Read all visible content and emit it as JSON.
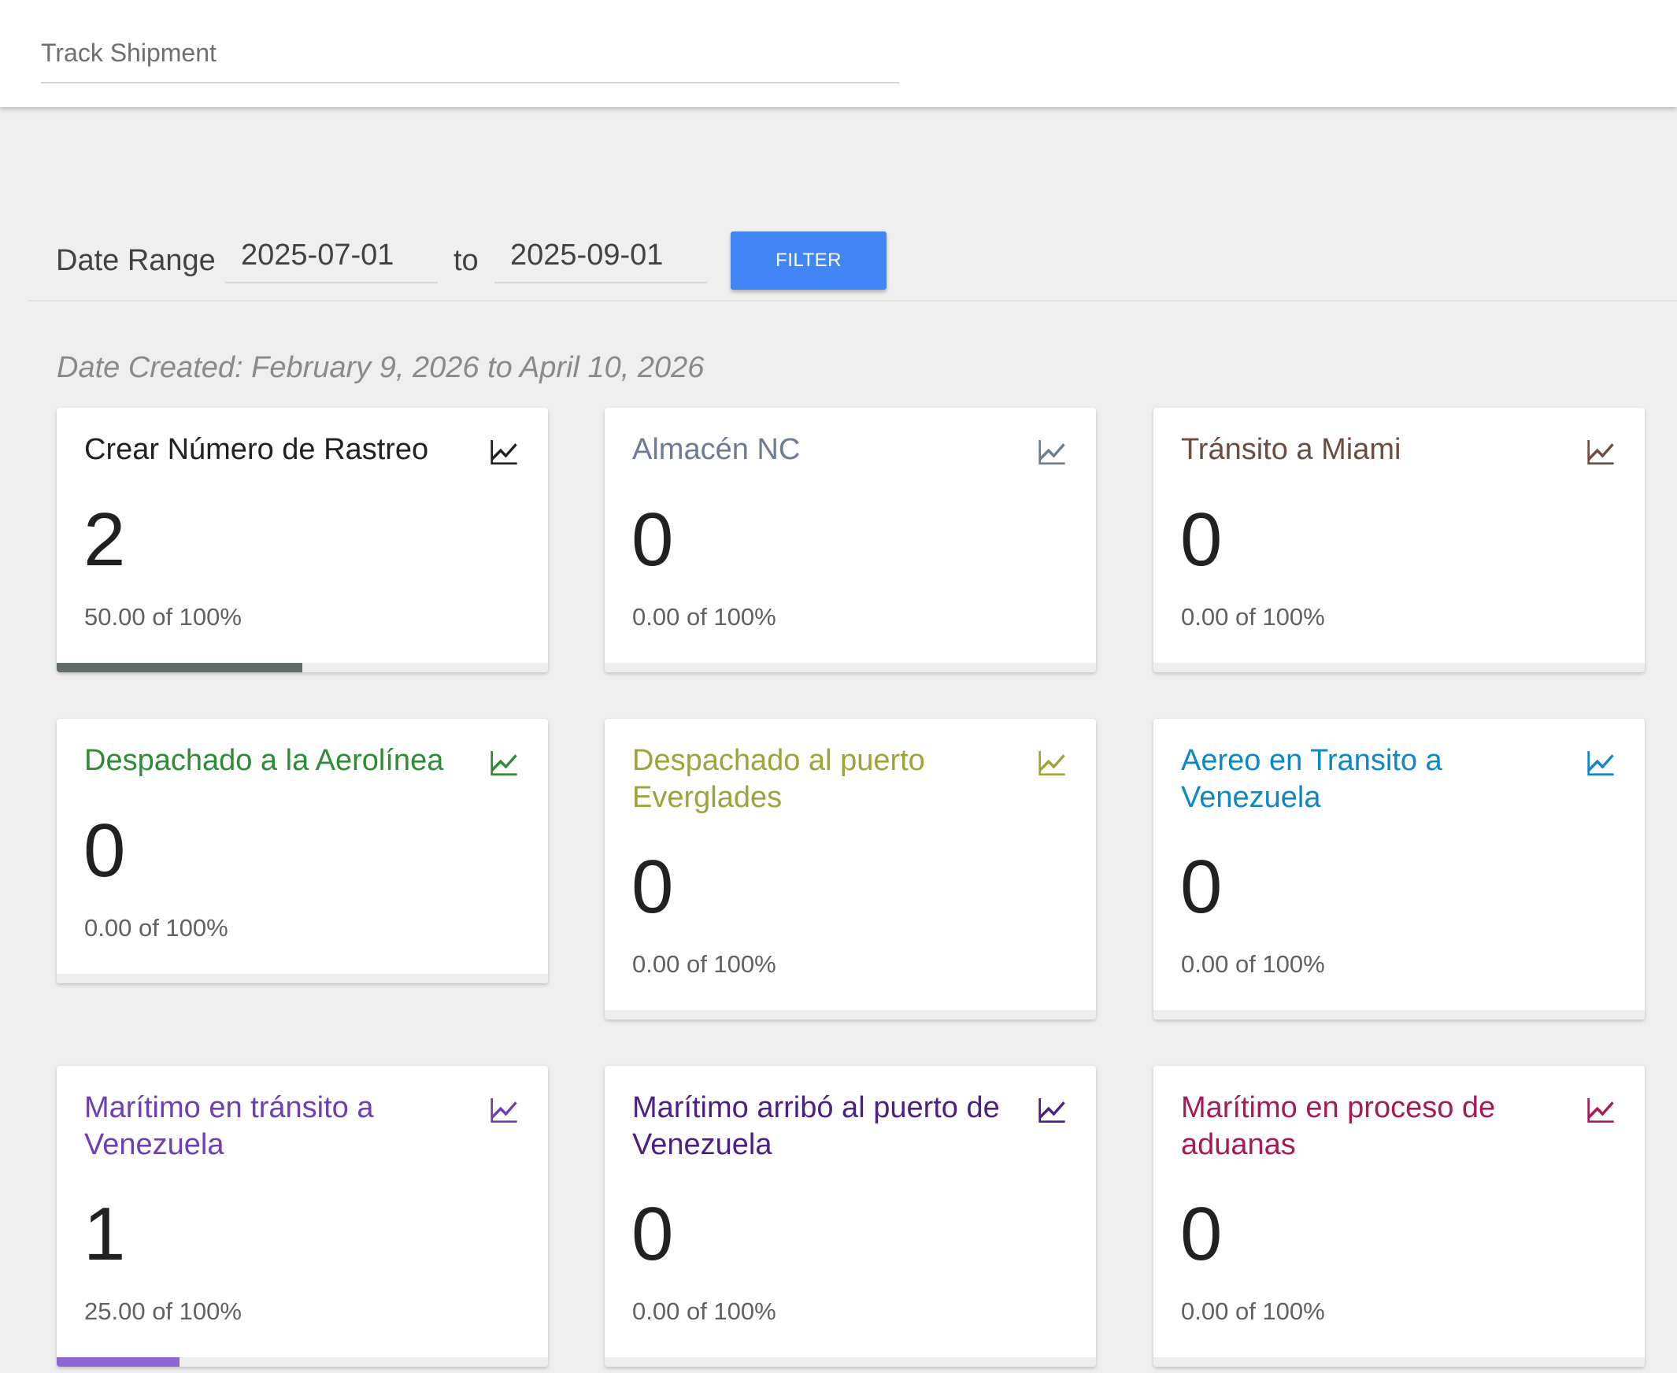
{
  "header": {
    "track_placeholder": "Track Shipment"
  },
  "filter": {
    "label": "Date Range",
    "from_value": "2025-07-01",
    "to_label": "to",
    "to_value": "2025-09-01",
    "button_label": "FILTER",
    "button_color": "#4285f4"
  },
  "date_created": "Date Created: February 9, 2026 to April 10, 2026",
  "cards": [
    {
      "title": "Crear Número de Rastreo",
      "count": "2",
      "percent_text": "50.00 of 100%",
      "progress": 0.5,
      "color": "#212121",
      "bar_color": "#616b6b",
      "icon": "trending-up-chart-icon"
    },
    {
      "title": "Almacén NC",
      "count": "0",
      "percent_text": "0.00 of 100%",
      "progress": 0,
      "color": "#6d7b95",
      "bar_color": "#6d7b95",
      "icon": "trending-up-chart-icon"
    },
    {
      "title": "Tránsito a Miami",
      "count": "0",
      "percent_text": "0.00 of 100%",
      "progress": 0,
      "color": "#6d4c41",
      "bar_color": "#6d4c41",
      "icon": "trending-up-chart-icon"
    },
    {
      "title": "Despachado a la Aerolínea",
      "count": "0",
      "percent_text": "0.00 of 100%",
      "progress": 0,
      "color": "#2e8b36",
      "bar_color": "#2e8b36",
      "icon": "trending-up-chart-icon"
    },
    {
      "title": "Despachado al puerto Everglades",
      "count": "0",
      "percent_text": "0.00 of 100%",
      "progress": 0,
      "color": "#9ea33a",
      "bar_color": "#9ea33a",
      "icon": "trending-up-chart-icon"
    },
    {
      "title": "Aereo en Transito a Venezuela",
      "count": "0",
      "percent_text": "0.00 of 100%",
      "progress": 0,
      "color": "#0d87c6",
      "bar_color": "#0d87c6",
      "icon": "trending-up-chart-icon"
    },
    {
      "title": "Marítimo en tránsito a Venezuela",
      "count": "1",
      "percent_text": "25.00 of 100%",
      "progress": 0.25,
      "color": "#6c3fb4",
      "bar_color": "#8f66d6",
      "icon": "trending-up-chart-icon"
    },
    {
      "title": "Marítimo arribó al puerto de Venezuela",
      "count": "0",
      "percent_text": "0.00 of 100%",
      "progress": 0,
      "color": "#4a1f86",
      "bar_color": "#4a1f86",
      "icon": "trending-up-chart-icon"
    },
    {
      "title": "Marítimo en proceso de aduanas",
      "count": "0",
      "percent_text": "0.00 of 100%",
      "progress": 0,
      "color": "#a8195a",
      "bar_color": "#a8195a",
      "icon": "trending-up-chart-icon"
    }
  ]
}
